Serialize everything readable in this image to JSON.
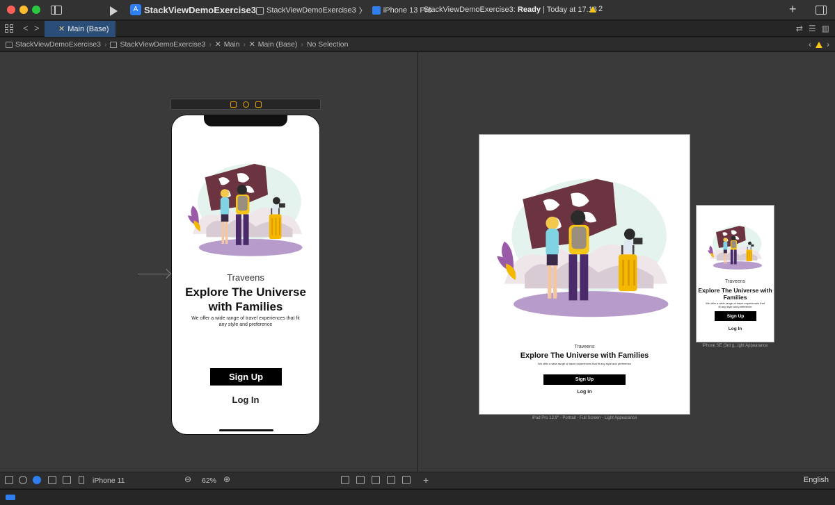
{
  "titlebar": {
    "project_title": "StackViewDemoExercise3",
    "scheme_name": "StackViewDemoExercise3",
    "scheme_sep": "〉",
    "device": "iPhone 13 Pro",
    "status_prefix": "StackViewDemoExercise3:",
    "status_state": "Ready",
    "status_time": "| Today at 17.18",
    "warning_count": "2"
  },
  "tabbar": {
    "active_tab": "Main (Base)"
  },
  "jumpbar": {
    "crumbs": [
      "StackViewDemoExercise3",
      "StackViewDemoExercise3",
      "Main",
      "Main (Base)",
      "No Selection"
    ]
  },
  "screen": {
    "brand": "Traveens",
    "headline": "Explore The Universe with Families",
    "subtitle": "We offer a wide range of travel experiences that fit any style and preference",
    "signup_label": "Sign Up",
    "login_label": "Log In"
  },
  "previews": {
    "ipad_caption": "iPad Pro 12.9\" - Portrait - Full Screen - Light Appearance",
    "se_caption": "iPhone SE (3rd g...ight Appearance"
  },
  "bottombar": {
    "device": "iPhone 11",
    "zoom": "62%",
    "language": "English"
  },
  "colors": {
    "accent_blue": "#2f7ff0",
    "warning_yellow": "#f5c518",
    "illus_map": "#6b3440",
    "illus_suitcase": "#f5b800",
    "illus_ground": "#b79ccb"
  }
}
